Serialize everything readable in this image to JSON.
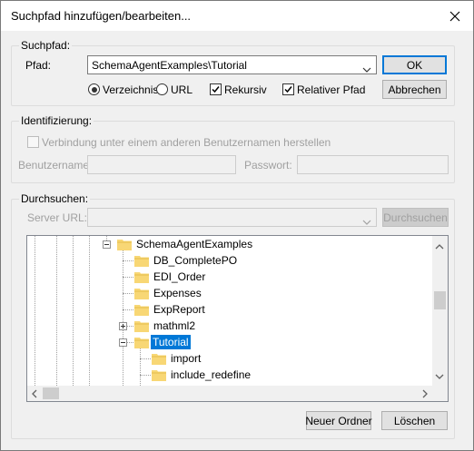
{
  "window": {
    "title": "Suchpfad hinzufügen/bearbeiten...",
    "close_icon": "close-icon"
  },
  "suchpfad": {
    "group_label": "Suchpfad:",
    "path_label": "Pfad:",
    "path_value": "SchemaAgentExamples\\Tutorial",
    "ok_label": "OK",
    "cancel_label": "Abbrechen",
    "options": {
      "verzeichnis": {
        "label": "Verzeichnis",
        "selected": true
      },
      "url": {
        "label": "URL",
        "selected": false
      },
      "rekursiv": {
        "label": "Rekursiv",
        "checked": true
      },
      "relativer_pfad": {
        "label": "Relativer Pfad",
        "checked": true
      }
    }
  },
  "identifizierung": {
    "group_label": "Identifizierung:",
    "other_user_label": "Verbindung unter einem anderen Benutzernamen herstellen",
    "username_label": "Benutzername:",
    "password_label": "Passwort:"
  },
  "durchsuchen": {
    "group_label": "Durchsuchen:",
    "server_url_label": "Server URL:",
    "browse_button": "Durchsuchen",
    "tree": [
      {
        "label": "SchemaAgentExamples",
        "level": 0,
        "expander": "minus"
      },
      {
        "label": "DB_CompletePO",
        "level": 1,
        "expander": null
      },
      {
        "label": "EDI_Order",
        "level": 1,
        "expander": null
      },
      {
        "label": "Expenses",
        "level": 1,
        "expander": null
      },
      {
        "label": "ExpReport",
        "level": 1,
        "expander": null
      },
      {
        "label": "mathml2",
        "level": 1,
        "expander": "plus"
      },
      {
        "label": "Tutorial",
        "level": 1,
        "expander": "minus",
        "selected": true
      },
      {
        "label": "import",
        "level": 2,
        "expander": null
      },
      {
        "label": "include_redefine",
        "level": 2,
        "expander": null
      }
    ],
    "new_folder_button": "Neuer Ordner",
    "delete_button": "Löschen"
  },
  "colors": {
    "dialog_bg": "#f0f0f0",
    "accent": "#0078d7",
    "folder": "#f8d775"
  }
}
